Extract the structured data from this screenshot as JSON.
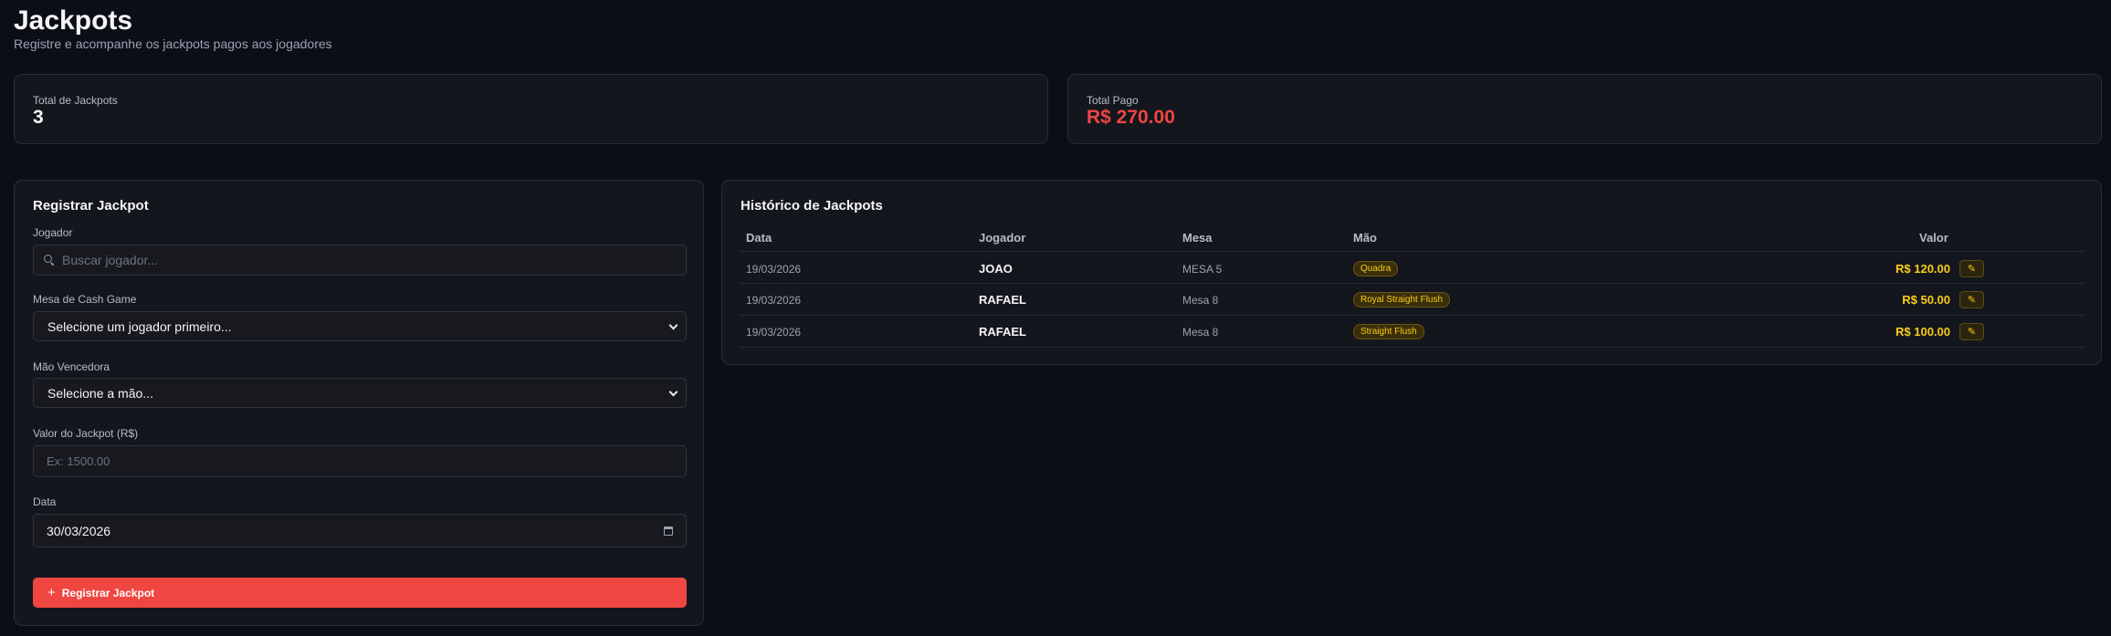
{
  "header": {
    "title": "Jackpots",
    "subtitle": "Registre e acompanhe os jackpots pagos aos jogadores"
  },
  "stats": {
    "total_label": "Total de Jackpots",
    "total_value": "3",
    "paid_label": "Total Pago",
    "paid_value": "R$ 270.00"
  },
  "form": {
    "title": "Registrar Jackpot",
    "player_label": "Jogador",
    "player_placeholder": "Buscar jogador...",
    "table_label": "Mesa de Cash Game",
    "table_value": "Selecione um jogador primeiro...",
    "hand_label": "Mão Vencedora",
    "hand_value": "Selecione a mão...",
    "amount_label": "Valor do Jackpot (R$)",
    "amount_placeholder": "Ex: 1500.00",
    "date_label": "Data",
    "date_value": "30/03/2026",
    "submit_label": "Registrar Jackpot"
  },
  "history": {
    "title": "Histórico de Jackpots",
    "columns": {
      "date": "Data",
      "player": "Jogador",
      "table": "Mesa",
      "hand": "Mão",
      "value": "Valor"
    },
    "rows": [
      {
        "date": "19/03/2026",
        "player": "JOAO",
        "table": "MESA 5",
        "hand": "Quadra",
        "value": "R$ 120.00"
      },
      {
        "date": "19/03/2026",
        "player": "RAFAEL",
        "table": "Mesa 8",
        "hand": "Royal Straight Flush",
        "value": "R$ 50.00"
      },
      {
        "date": "19/03/2026",
        "player": "RAFAEL",
        "table": "Mesa 8",
        "hand": "Straight Flush",
        "value": "R$ 100.00"
      }
    ]
  },
  "colors": {
    "accent": "#f04641",
    "gold": "#facc15",
    "background": "#0b0e17"
  },
  "icons": {
    "search": "search-icon",
    "plus": "plus-icon",
    "edit": "pencil-icon",
    "calendar": "calendar-icon",
    "dropdown": "chevron-down-icon"
  }
}
